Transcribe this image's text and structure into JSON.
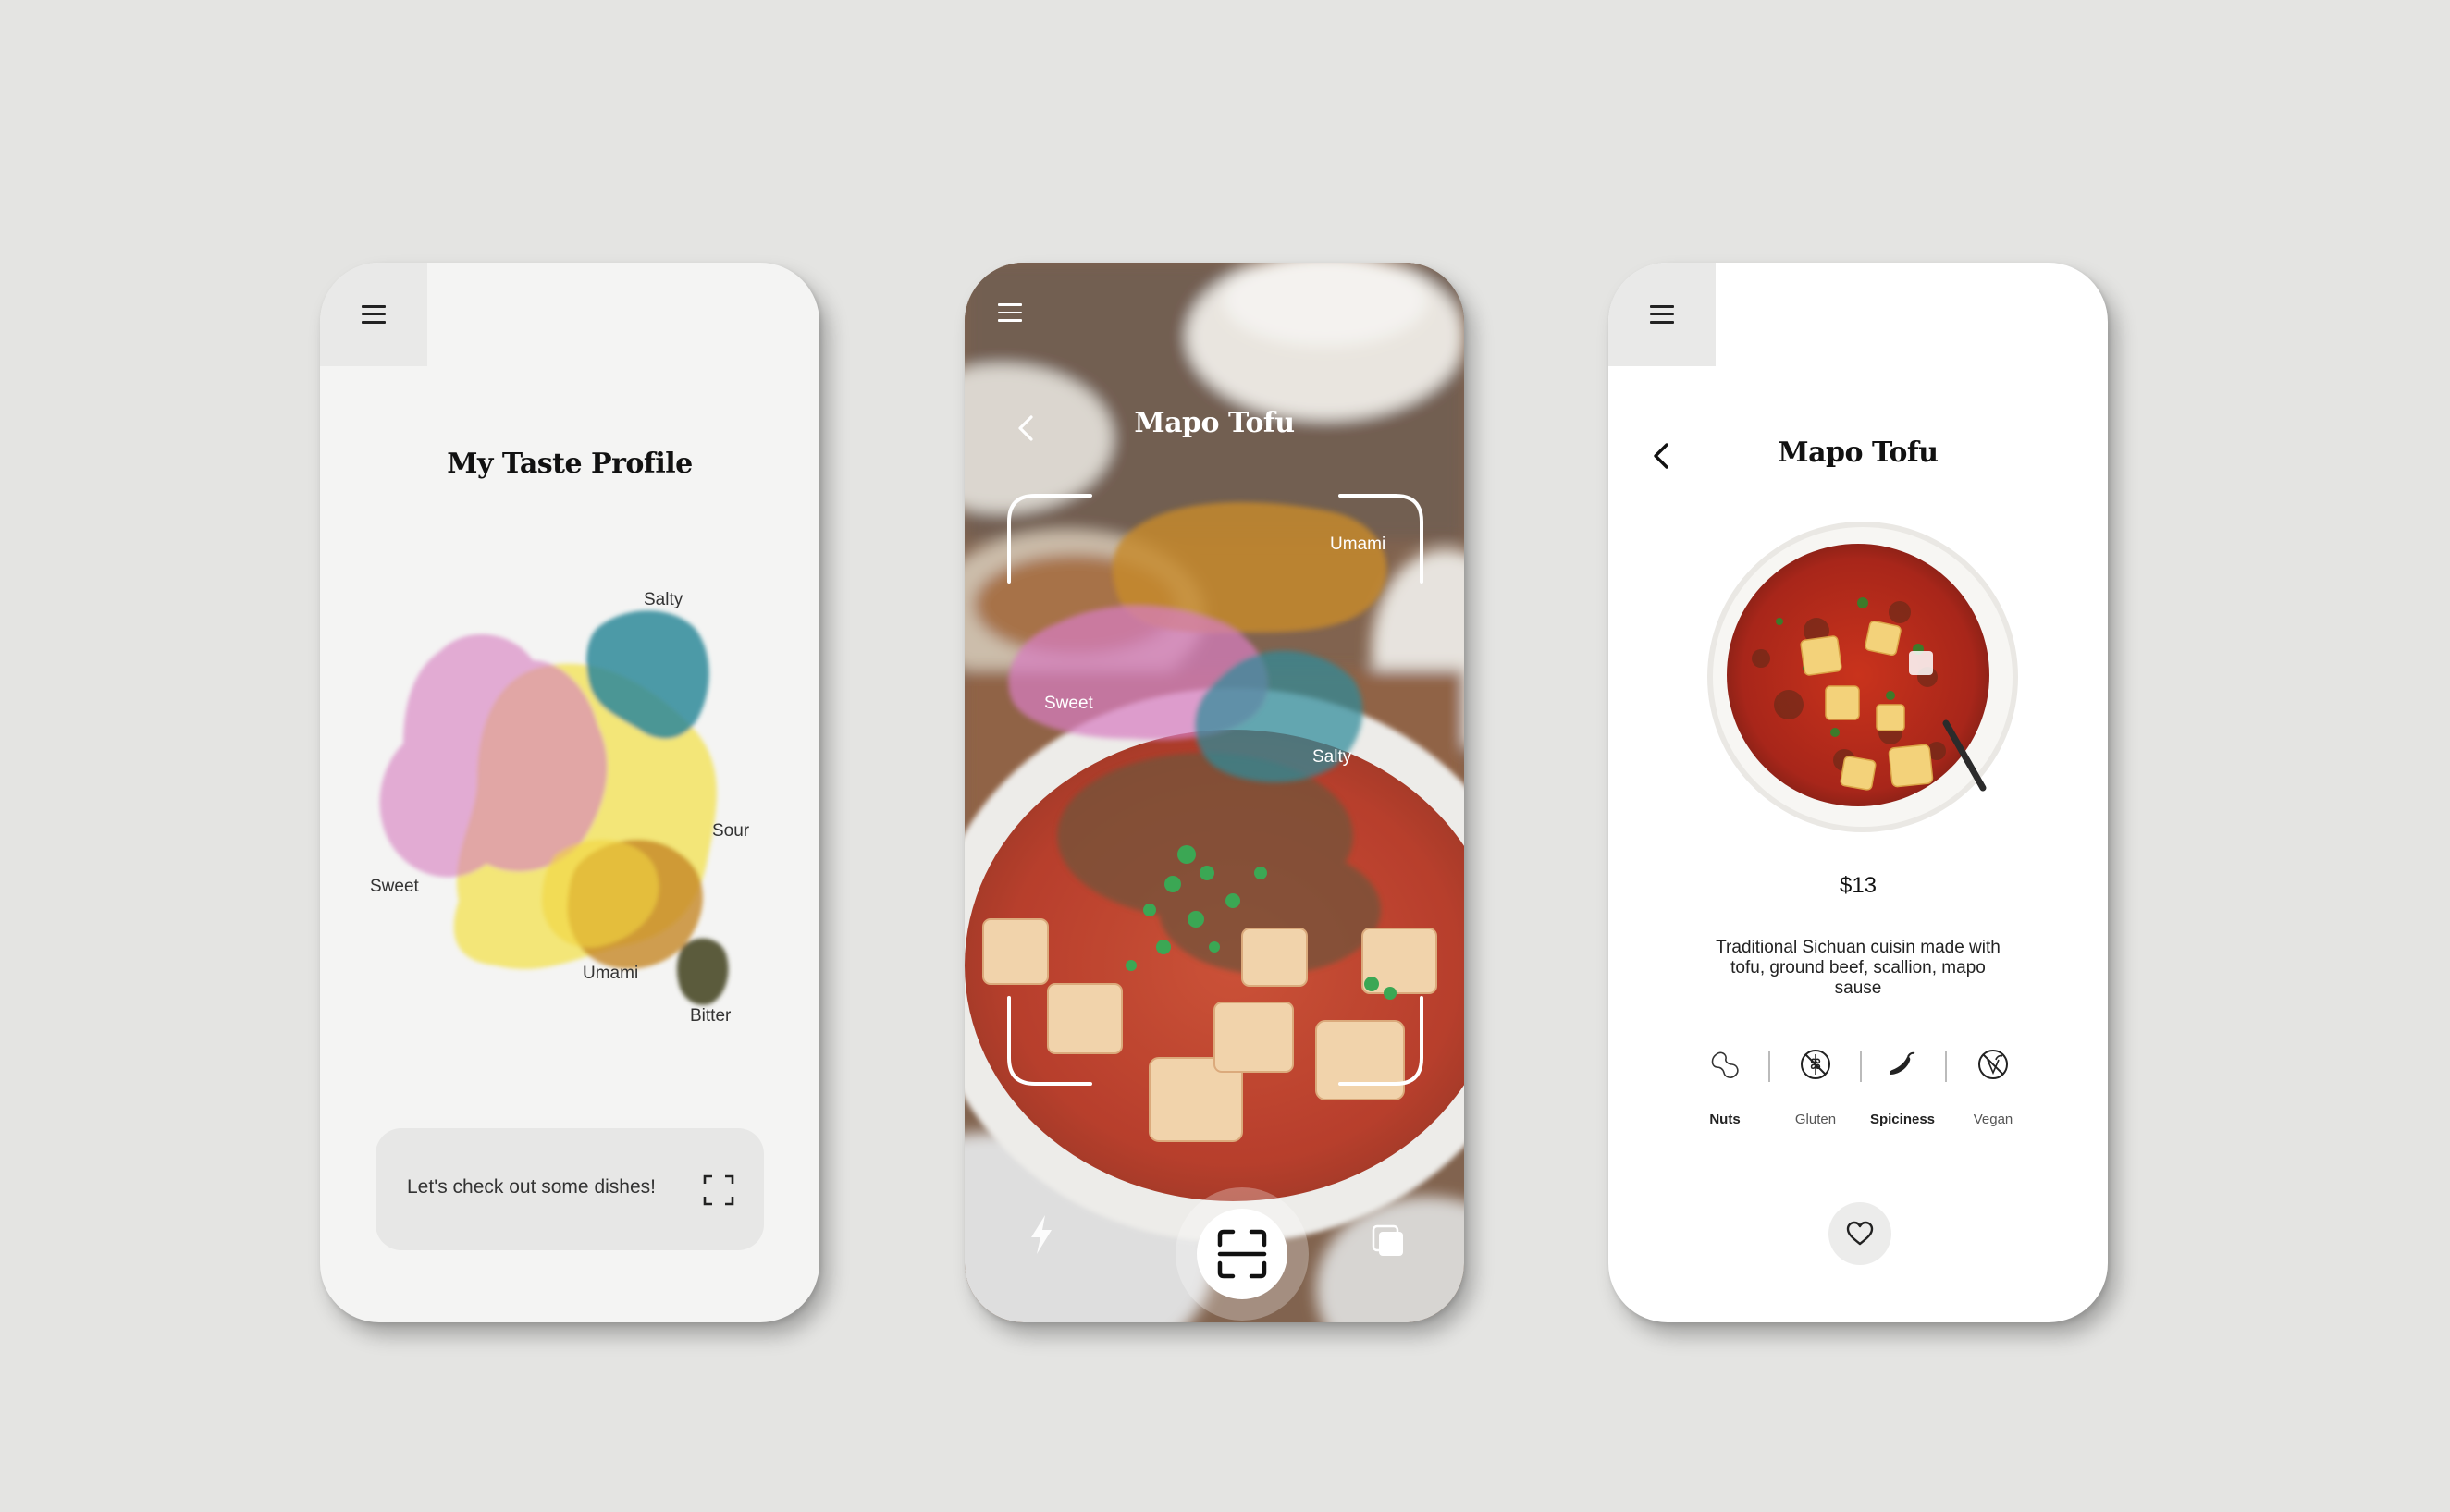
{
  "colors": {
    "background": "#e4e4e2",
    "sweet": "#d77ec0",
    "sour": "#f2e04a",
    "salty": "#2f8a9a",
    "umami": "#c78a2a",
    "bitter": "#4b4a2a"
  },
  "taste_profile_screen": {
    "menu_icon": "hamburger-menu-icon",
    "title": "My Taste Profile",
    "tastes": {
      "salty": "Salty",
      "sour": "Sour",
      "sweet": "Sweet",
      "umami": "Umami",
      "bitter": "Bitter"
    },
    "cta_label": "Let's check out some dishes!",
    "cta_icon": "scan-frame-icon"
  },
  "camera_screen": {
    "menu_icon": "hamburger-menu-icon",
    "back_icon": "chevron-left-icon",
    "title": "Mapo Tofu",
    "detected_tastes": {
      "umami": "Umami",
      "sweet": "Sweet",
      "salty": "Salty"
    },
    "flash_icon": "lightning-icon",
    "shutter_icon": "scan-frame-icon",
    "gallery_icon": "gallery-icon"
  },
  "dish_screen": {
    "menu_icon": "hamburger-menu-icon",
    "back_icon": "chevron-left-icon",
    "title": "Mapo Tofu",
    "price": "$13",
    "description": "Traditional Sichuan cuisin made with tofu, ground beef, scallion, mapo sause",
    "allergens": [
      {
        "label": "Nuts",
        "icon": "peanut-icon",
        "highlighted": true
      },
      {
        "label": "Gluten",
        "icon": "gluten-free-icon",
        "highlighted": false
      },
      {
        "label": "Spiciness",
        "icon": "chili-pepper-icon",
        "highlighted": true
      },
      {
        "label": "Vegan",
        "icon": "not-vegan-icon",
        "highlighted": false
      }
    ],
    "favorite_icon": "heart-icon"
  }
}
